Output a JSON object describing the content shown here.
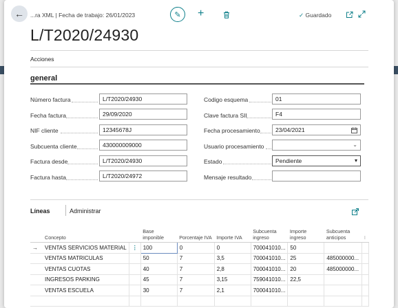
{
  "header": {
    "breadcrumb": "...ra XML | Fecha de trabajo: 26/01/2023",
    "saved_label": "Guardado"
  },
  "page_title": "L/T2020/24930",
  "actions_label": "Acciones",
  "section_title": "general",
  "fields_left": [
    {
      "label": "Número factura",
      "value": "L/T2020/24930"
    },
    {
      "label": "Fecha factura",
      "value": "29/09/2020"
    },
    {
      "label": "NIF cliente",
      "value": "12345678J"
    },
    {
      "label": "Subcuenta cliente",
      "value": "430000009000"
    },
    {
      "label": "Factura desde",
      "value": "L/T2020/24930"
    },
    {
      "label": "Factura hasta",
      "value": "L/T2020/24972"
    }
  ],
  "fields_right": [
    {
      "label": "Codigo esquema",
      "value": "01"
    },
    {
      "label": "Clave factura SII",
      "value": "F4"
    },
    {
      "label": "Fecha procesamiento",
      "value": "23/04/2021"
    },
    {
      "label": "Usuario procesamiento",
      "value": ""
    },
    {
      "label": "Estado",
      "value": "Pendiente"
    },
    {
      "label": "Mensaje resultado",
      "value": ""
    }
  ],
  "lines": {
    "tab_label": "Líneas",
    "manage_label": "Administrar",
    "columns": [
      "Concepto",
      "Base imponible",
      "Porcentaje IVA",
      "Importe IVA",
      "Subcuenta ingreso",
      "Importe ingreso",
      "Subcuenta anticipos"
    ],
    "rows": [
      [
        "VENTAS SERVICIOS MATERIAL",
        "100",
        "0",
        "0",
        "700041010...",
        "50",
        ""
      ],
      [
        "VENTAS MATRICULAS",
        "50",
        "7",
        "3,5",
        "700041010...",
        "25",
        "485000000..."
      ],
      [
        "VENTAS CUOTAS",
        "40",
        "7",
        "2,8",
        "700041010...",
        "20",
        "485000000..."
      ],
      [
        "INGRESOS PARKING",
        "45",
        "7",
        "3,15",
        "759041010...",
        "22,5",
        ""
      ],
      [
        "VENTAS ESCUELA",
        "30",
        "7",
        "2,1",
        "700041010...",
        "",
        ""
      ],
      [
        "",
        "",
        "",
        "",
        "",
        "",
        ""
      ]
    ]
  }
}
